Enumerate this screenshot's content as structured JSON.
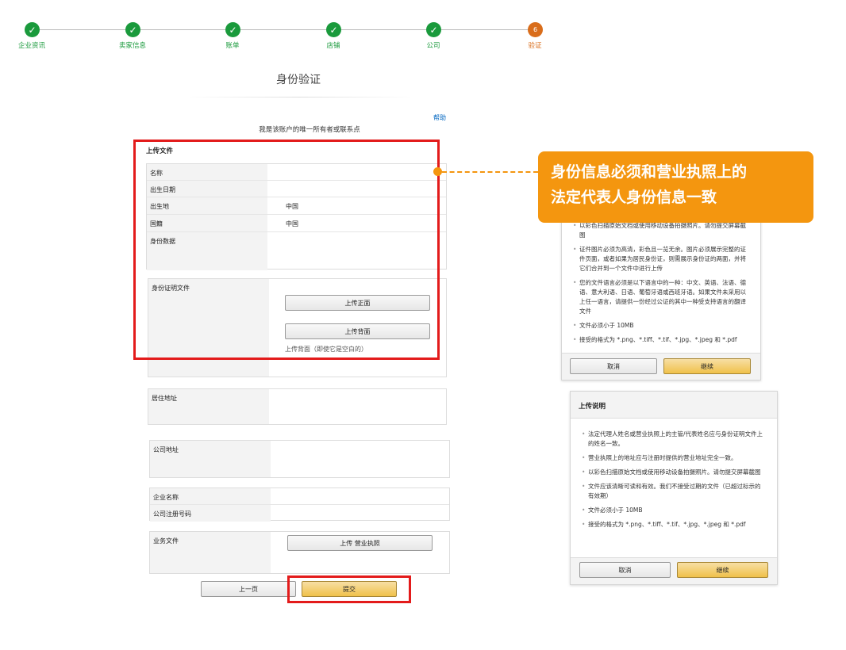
{
  "steps": [
    {
      "label": "企业资讯",
      "done": true
    },
    {
      "label": "卖家信息",
      "done": true
    },
    {
      "label": "账单",
      "done": true
    },
    {
      "label": "店铺",
      "done": true
    },
    {
      "label": "公司",
      "done": true
    },
    {
      "label": "验证",
      "done": false,
      "number": "6"
    }
  ],
  "page": {
    "title": "身份验证",
    "help": "帮助",
    "subtitle": "我是该账户的唯一所有者或联系点"
  },
  "upload": {
    "section_title": "上传文件",
    "name_label": "名称",
    "dob_label": "出生日期",
    "birthplace_label": "出生地",
    "birthplace_value": "中国",
    "nationality_label": "国籍",
    "nationality_value": "中国",
    "id_data_label": "身份数据",
    "id_doc_label": "身份证明文件",
    "upload_front": "上传正面",
    "upload_back": "上传背面",
    "upload_back_note": "上传背面（即使它是空白的）"
  },
  "residence": {
    "label": "居住地址"
  },
  "company_address": {
    "label": "公司地址"
  },
  "company": {
    "name_label": "企业名称",
    "reg_label": "公司注册号码"
  },
  "business_doc": {
    "label": "业务文件",
    "upload_button": "上传 营业执照"
  },
  "nav": {
    "prev": "上一页",
    "submit": "提交"
  },
  "callout": {
    "line1": "身份信息必须和营业执照上的",
    "line2": "法定代表人身份信息一致"
  },
  "dialog1": {
    "partial_top": "以彩色扫描原始文档或使用移动设备拍摄照片。请勿提交屏幕截图",
    "items": [
      "证件图片必须为高清，彩色且一览无余。图片必须展示完整的证件页面，或者如果为居民身份证，则需展示身份证的两面，并将它们合并到一个文件中进行上传",
      "您的文件语言必须是以下语言中的一种：中文、英语、法语、德语、意大利语、日语、葡萄牙语或西班牙语。如果文件未采用以上任一语言，请提供一份经过公证的其中一种受支持语言的翻译文件",
      "文件必须小于 10MB",
      "接受的格式为 *.png、*.tiff、*.tif、*.jpg、*.jpeg 和 *.pdf"
    ],
    "cancel": "取消",
    "continue": "继续"
  },
  "dialog2": {
    "title": "上传说明",
    "items": [
      "法定代理人姓名或营业执照上的主管/代表姓名应与身份证明文件上的姓名一致。",
      "营业执照上的地址应与注册时提供的营业地址完全一致。",
      "以彩色扫描原始文档或使用移动设备拍摄照片。请勿提交屏幕截图",
      "文件应该清晰可读和有效。我们不接受过期的文件（已超过标示的有效期）",
      "文件必须小于 10MB",
      "接受的格式为 *.png、*.tiff、*.tif、*.jpg、*.jpeg 和 *.pdf"
    ],
    "cancel": "取消",
    "continue": "继续"
  },
  "colors": {
    "step_done": "#1a9a3c",
    "step_current": "#d96d1b",
    "highlight": "#e31b1b",
    "callout": "#f4960f"
  }
}
